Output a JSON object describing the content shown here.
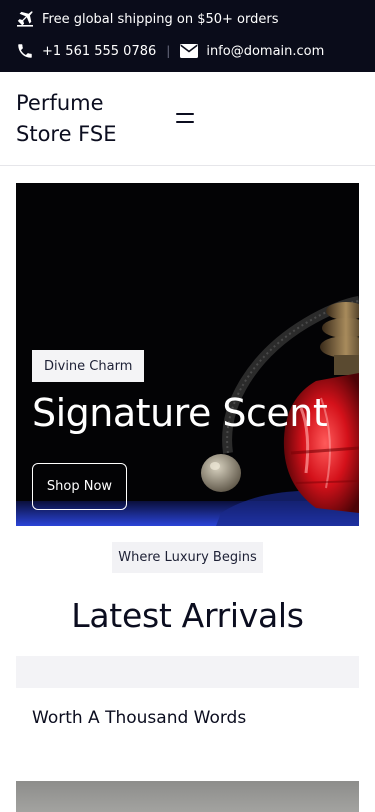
{
  "topbar": {
    "shipping_text": "Free global shipping on $50+ orders",
    "phone": "+1 561 555 0786",
    "separator": "|",
    "email": "info@domain.com",
    "icons": [
      "plane-icon",
      "phone-icon",
      "envelope-icon"
    ]
  },
  "header": {
    "site_title": "Perfume Store FSE",
    "menu_icon": "menu-icon"
  },
  "hero": {
    "tag": "Divine Charm",
    "title": "Signature Scent",
    "button_label": "Shop Now"
  },
  "section": {
    "pill": "Where Luxury Begins",
    "title": "Latest Arrivals"
  },
  "products": [
    {
      "title": "Worth A Thousand Words"
    }
  ],
  "colors": {
    "topbar_bg": "#0a0c1a",
    "text_dark": "#0b0d1f",
    "pill_bg": "#f2f2f5",
    "hero_bg": "#030305"
  }
}
